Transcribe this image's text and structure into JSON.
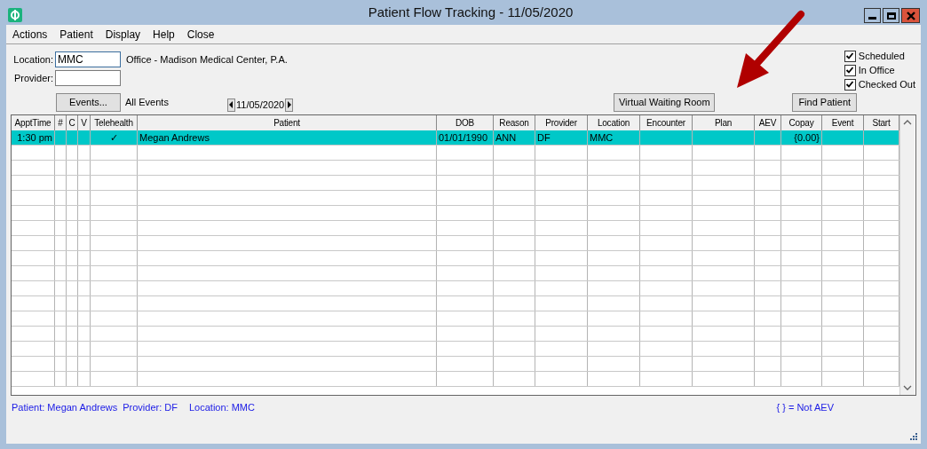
{
  "window": {
    "title": "Patient Flow Tracking - 11/05/2020"
  },
  "menu": [
    "Actions",
    "Patient",
    "Display",
    "Help",
    "Close"
  ],
  "filters": {
    "location_label": "Location:",
    "location_value": "MMC",
    "location_name": "Office - Madison Medical Center, P.A.",
    "provider_label": "Provider:",
    "events_button": "Events...",
    "events_value": "All Events",
    "date": "11/05/2020"
  },
  "status_filters": [
    {
      "label": "Scheduled",
      "checked": true
    },
    {
      "label": "In Office",
      "checked": true
    },
    {
      "label": "Checked Out",
      "checked": true
    }
  ],
  "buttons": {
    "virtual_waiting_room": "Virtual Waiting Room",
    "find_patient": "Find Patient"
  },
  "table": {
    "columns": [
      "ApptTime",
      "#",
      "C",
      "V",
      "Telehealth",
      "Patient",
      "DOB",
      "Reason",
      "Provider",
      "Location",
      "Encounter",
      "Plan",
      "AEV",
      "Copay",
      "Event",
      "Start"
    ],
    "rows": [
      {
        "selected": true,
        "cells": [
          "1:30 pm",
          "",
          "",
          "",
          "✓",
          "Megan Andrews",
          "01/01/1990",
          "ANN",
          "DF",
          "MMC",
          "",
          "",
          "",
          "{0.00}",
          "",
          ""
        ]
      }
    ]
  },
  "status_bar": {
    "patient": "Patient: Megan Andrews",
    "provider": "Provider: DF",
    "location": "Location: MMC",
    "legend": "{ } = Not AEV"
  }
}
